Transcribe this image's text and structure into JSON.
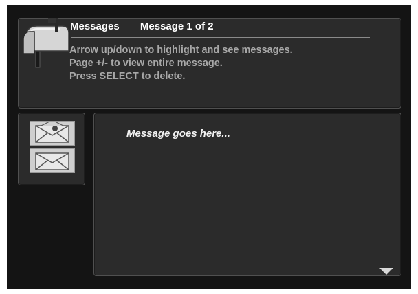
{
  "header": {
    "title": "Messages",
    "message_counter": "Message  1 of 2",
    "instructions": [
      "Arrow up/down to highlight and see messages.",
      "Page +/- to view entire message.",
      "Press SELECT to delete."
    ],
    "icon": "mailbox-icon"
  },
  "messages": {
    "items": [
      {
        "icon": "envelope-read-icon",
        "state": "highlighted"
      },
      {
        "icon": "envelope-unread-icon",
        "state": "normal"
      }
    ]
  },
  "body": {
    "text": "Message goes here...",
    "scroll_icon": "scroll-down-arrow-icon"
  }
}
